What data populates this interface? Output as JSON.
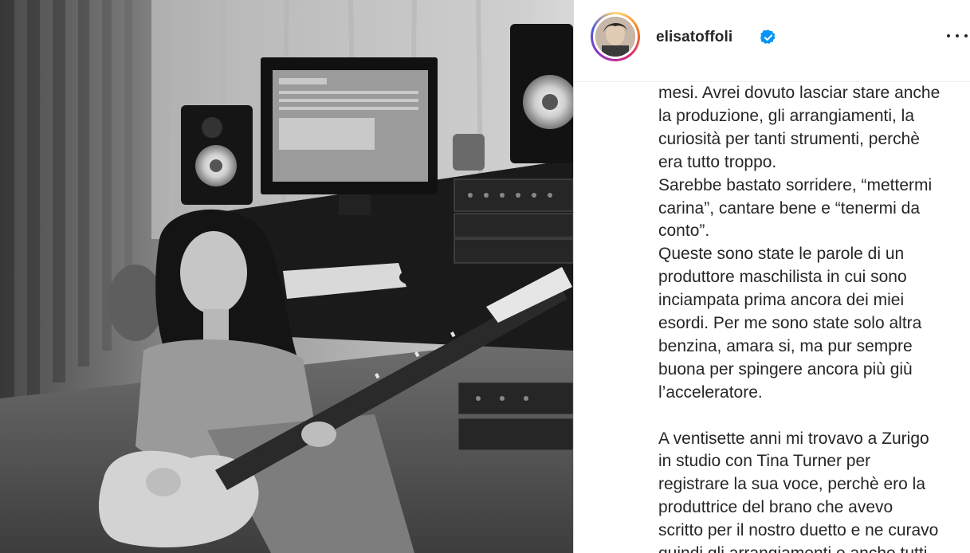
{
  "post": {
    "username": "elisatoffoli",
    "verified": true,
    "caption_paragraphs": [
      "mesi. Avrei dovuto lasciar stare anche\nla produzione, gli arrangiamenti, la\ncuriosità per tanti strumenti, perchè\nera tutto troppo.",
      "Sarebbe bastato sorridere, “mettermi\ncarina”, cantare bene e “tenermi da\nconto”.",
      "Queste sono state le parole di un\nproduttore maschilista in cui sono\ninciampata prima ancora dei miei\nesordi. Per me sono state solo altra\nbenzina, amara si, ma pur sempre\nbuona per spingere ancora più giù\nl’acceleratore.",
      "A ventisette anni mi trovavo a Zurigo\nin studio con Tina Turner per\nregistrare la sua voce, perchè ero la\nproduttrice del brano che avevo\nscritto per il nostro duetto e ne curavo\nquindi gli arrangiamenti e anche tutti"
    ]
  },
  "icons": {
    "verified": "verified-badge-icon",
    "more": "more-options-icon"
  },
  "colors": {
    "verified_blue": "#0095f6",
    "text": "#262626",
    "border": "#dbdbdb"
  }
}
